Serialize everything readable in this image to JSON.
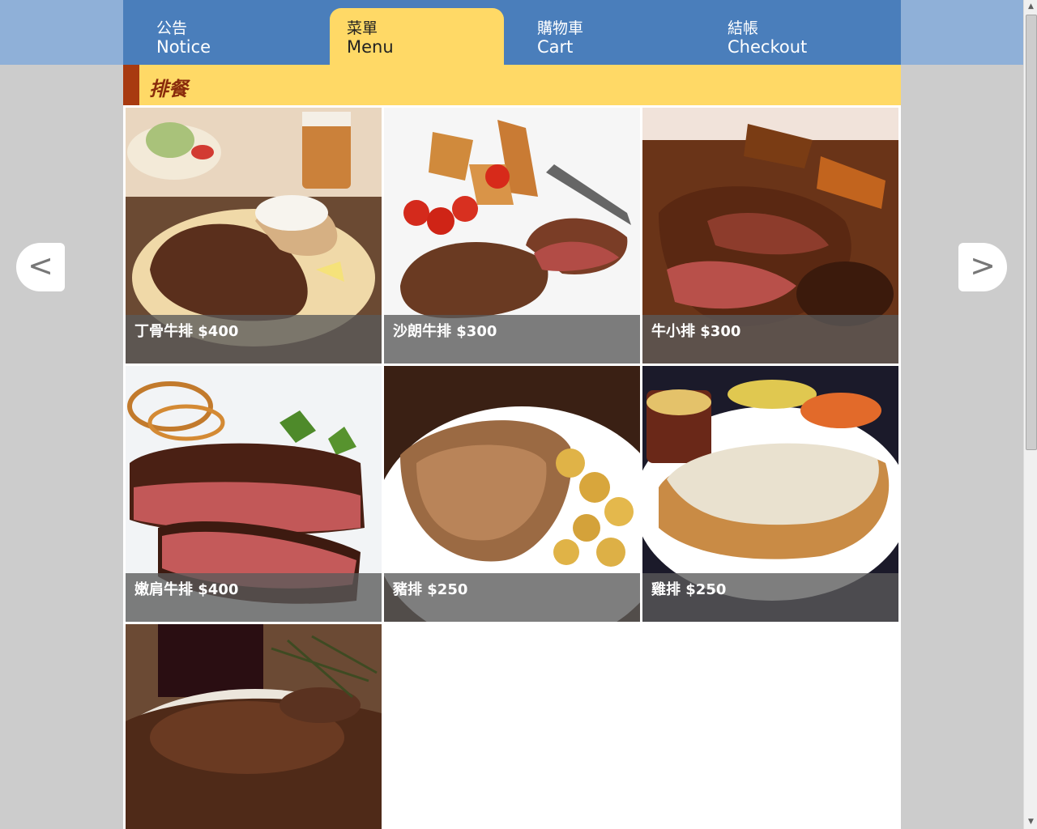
{
  "nav": {
    "tabs": [
      {
        "zh": "公告",
        "en": "Notice"
      },
      {
        "zh": "菜單",
        "en": "Menu"
      },
      {
        "zh": "購物車",
        "en": "Cart"
      },
      {
        "zh": "結帳",
        "en": "Checkout"
      }
    ],
    "active_tab": 1
  },
  "category": {
    "title": "排餐"
  },
  "menu_items": [
    {
      "label": "丁骨牛排 $400"
    },
    {
      "label": "沙朗牛排 $300"
    },
    {
      "label": "牛小排 $300"
    },
    {
      "label": "嫩肩牛排 $400"
    },
    {
      "label": "豬排 $250"
    },
    {
      "label": "雞排 $250"
    },
    {
      "label": ""
    }
  ],
  "arrows": {
    "prev": "<",
    "next": ">"
  },
  "colors": {
    "nav_bg": "#4a7ebb",
    "active_tab": "#ffd966",
    "category_bar": "#ffd966",
    "category_accent": "#a83a10",
    "page_bg": "#cccccc"
  },
  "scrollbar": {
    "up": "▲",
    "down": "▼"
  }
}
